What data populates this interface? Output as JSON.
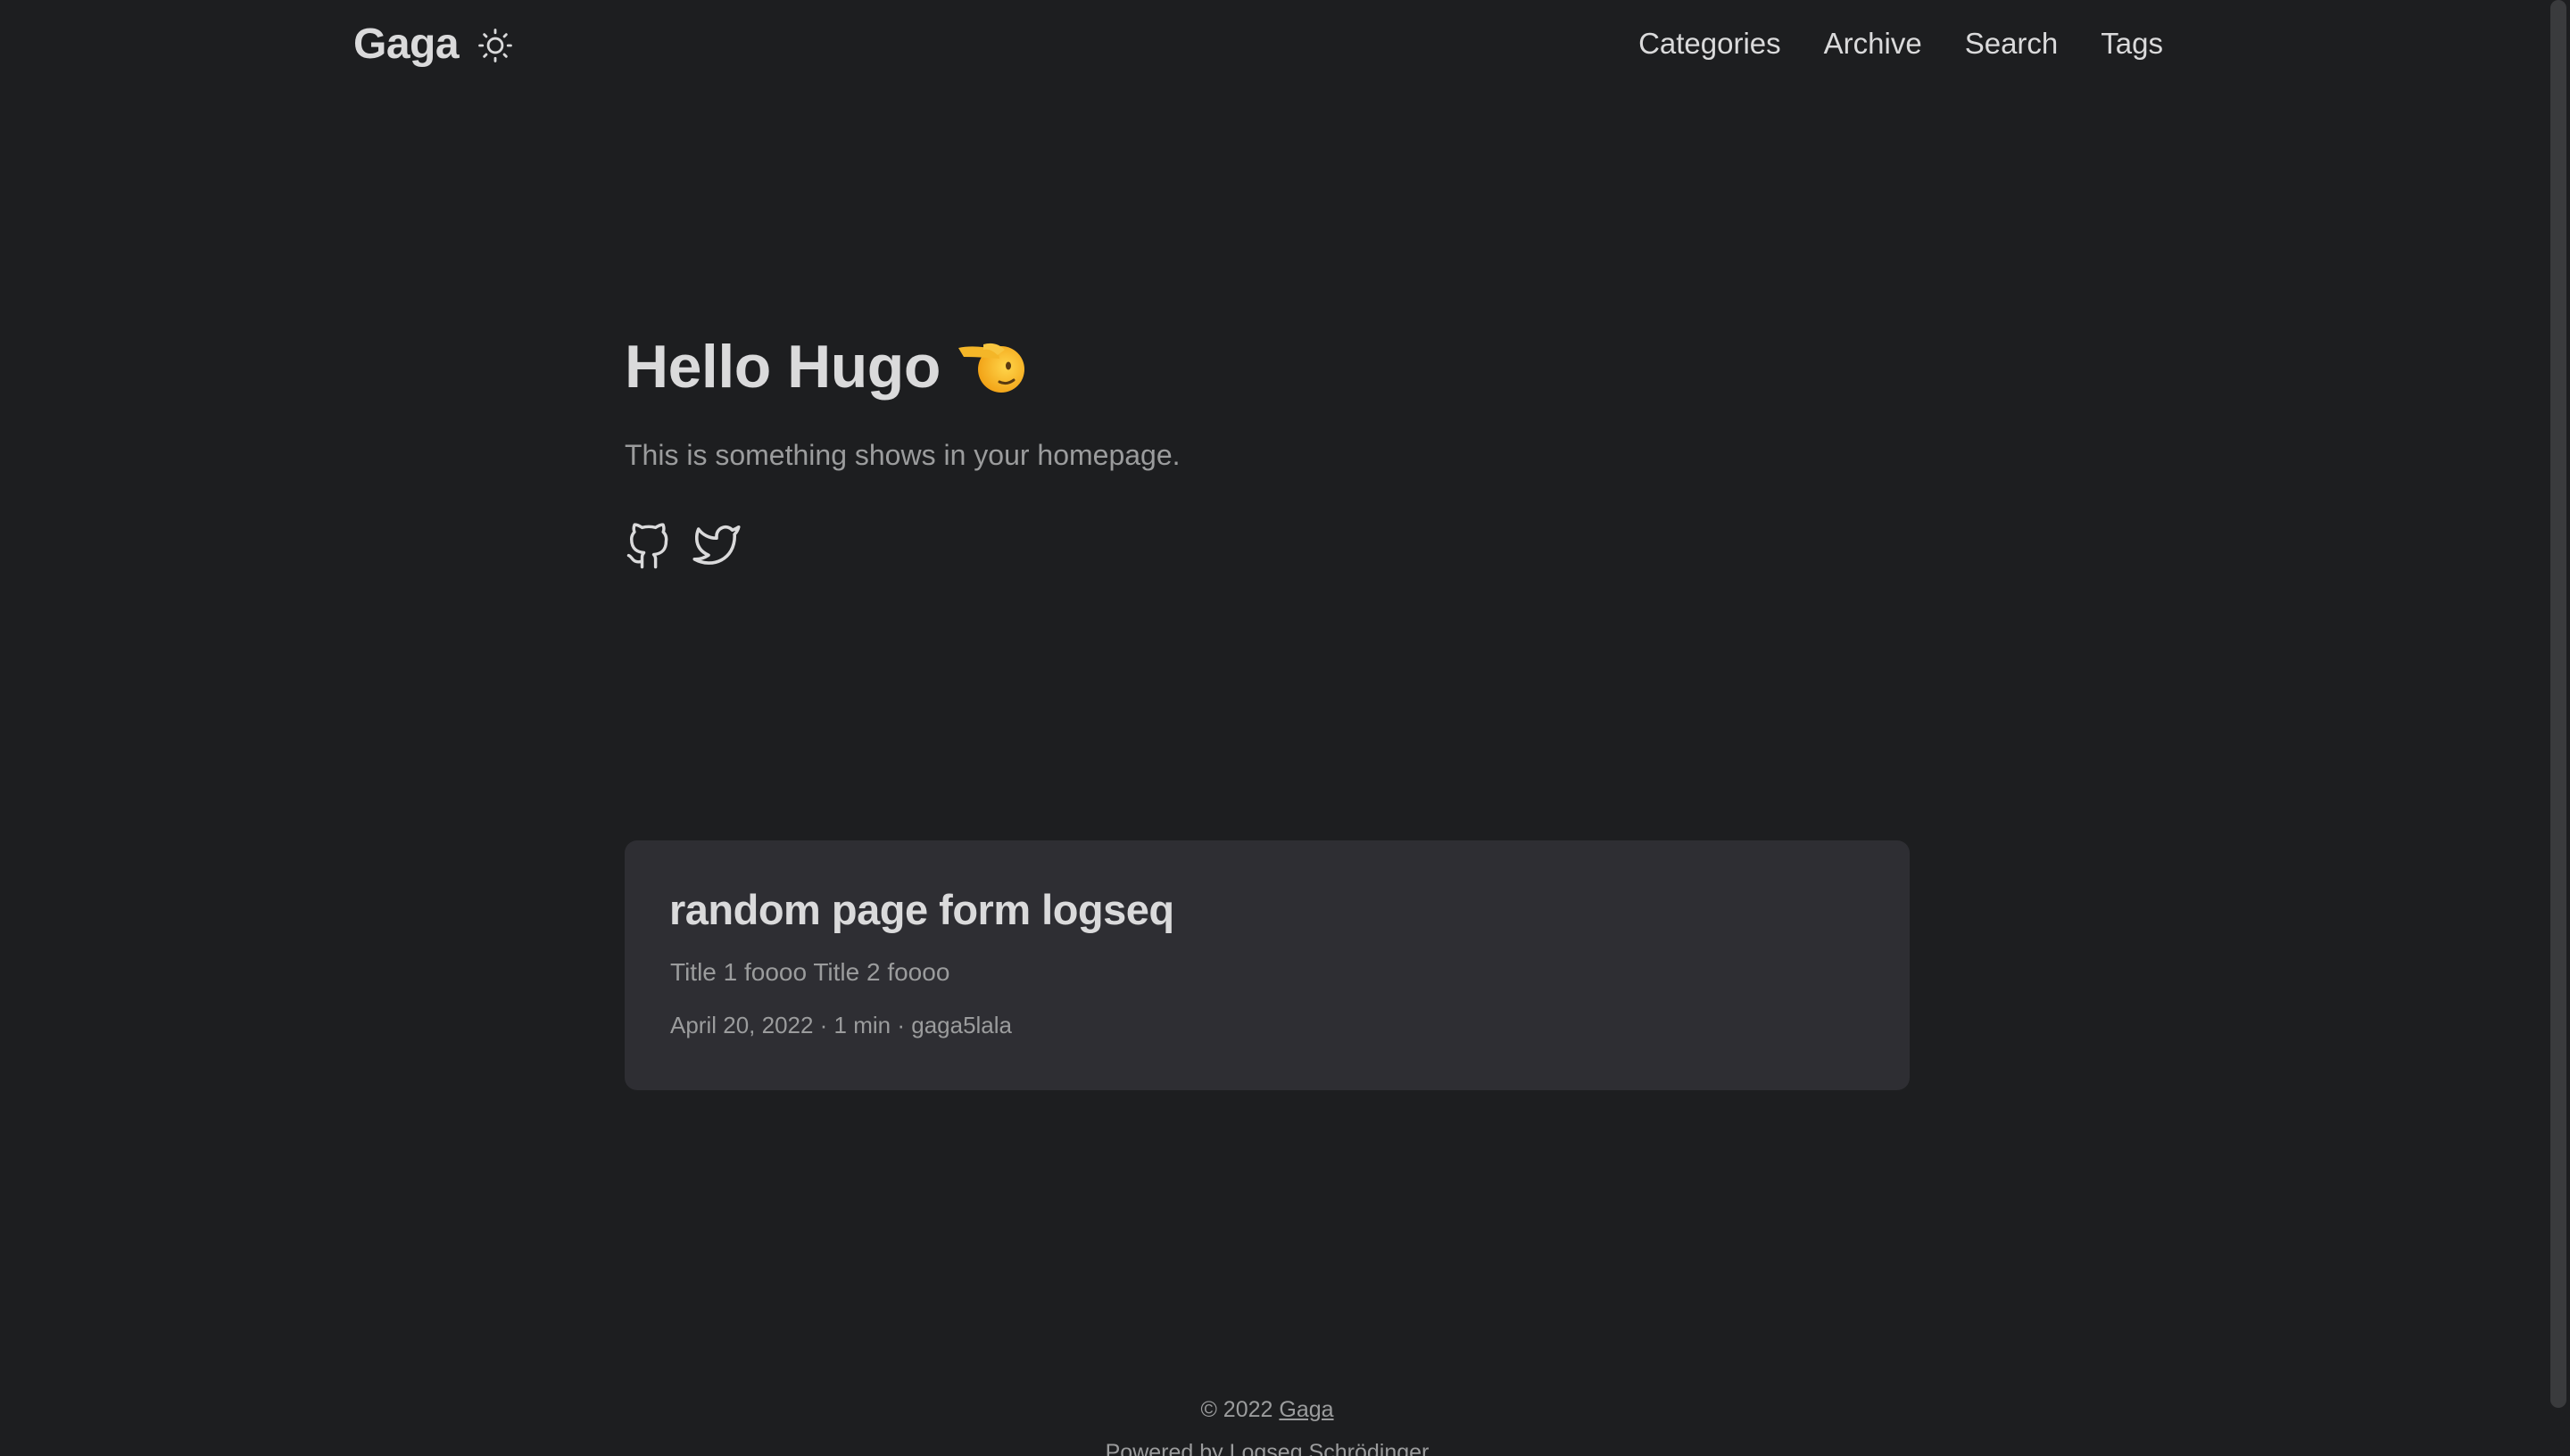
{
  "header": {
    "logo": "Gaga",
    "theme_icon": "sun-icon",
    "nav": [
      {
        "label": "Categories"
      },
      {
        "label": "Archive"
      },
      {
        "label": "Search"
      },
      {
        "label": "Tags"
      }
    ]
  },
  "profile": {
    "title": "Hello Hugo",
    "emoji": "saluting-face-emoji",
    "subtitle": "This is something shows in your homepage.",
    "social": [
      {
        "icon": "github-icon"
      },
      {
        "icon": "twitter-icon"
      }
    ]
  },
  "posts": [
    {
      "title": "random page form logseq",
      "excerpt": "Title 1 foooo Title 2 foooo",
      "meta": "April 20, 2022 · 1 min · gaga5lala"
    }
  ],
  "footer": {
    "copyright_prefix": "© 2022",
    "site_link": "Gaga",
    "powered_by": "Powered by Logseq Schrödinger"
  },
  "colors": {
    "background": "#1d1e20",
    "card": "#2e2e33",
    "primary_text": "#dadadb",
    "secondary_text": "#9b9c9d"
  }
}
